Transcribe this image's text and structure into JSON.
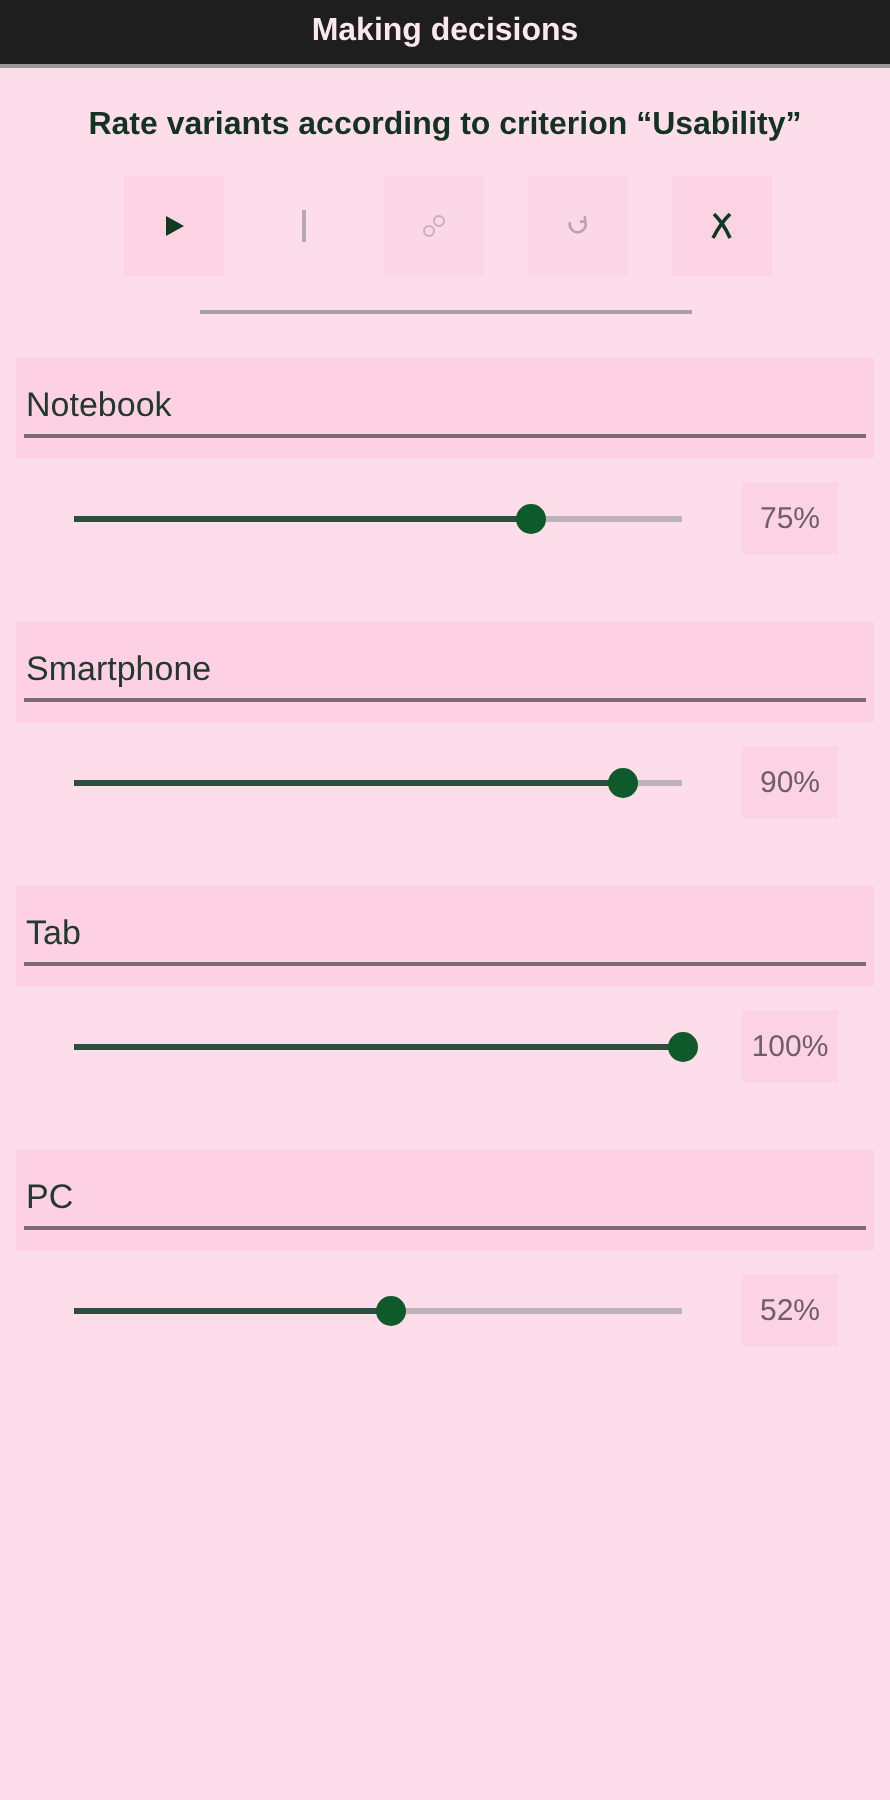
{
  "window": {
    "title": "Making decisions"
  },
  "heading": "Rate variants according to criterion “Usability”",
  "toolbar": [
    {
      "kind": "play",
      "disabled": false
    },
    {
      "kind": "separator",
      "disabled": false
    },
    {
      "kind": "link",
      "disabled": true
    },
    {
      "kind": "refresh",
      "disabled": true
    },
    {
      "kind": "cancel",
      "disabled": false
    }
  ],
  "variants": [
    {
      "name": "Notebook",
      "level": 0.75,
      "reading": "75%"
    },
    {
      "name": "Smartphone",
      "level": 0.9,
      "reading": "90%"
    },
    {
      "name": "Tab",
      "level": 1.0,
      "reading": "100%"
    },
    {
      "name": "PC",
      "level": 0.52,
      "reading": "52%"
    }
  ]
}
